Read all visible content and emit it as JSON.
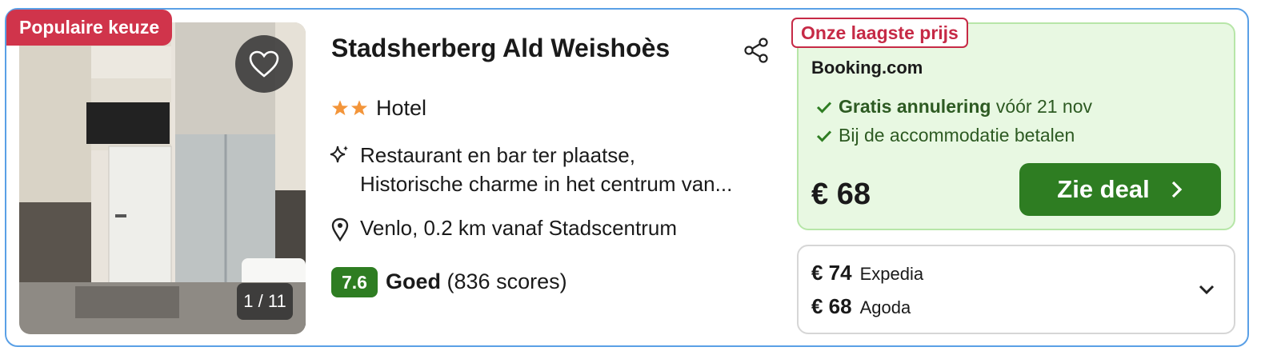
{
  "badge": {
    "popular": "Populaire keuze"
  },
  "image": {
    "counter": "1 / 11"
  },
  "hotel": {
    "name": "Stadsherberg Ald Weishoès",
    "stars": 2,
    "type": "Hotel",
    "amenities_line1": "Restaurant en bar ter plaatse,",
    "amenities_line2": "Historische charme in het centrum van...",
    "location": "Venlo, 0.2 km vanaf Stadscentrum",
    "rating_score": "7.6",
    "rating_label": "Goed",
    "rating_count": "(836 scores)"
  },
  "deal": {
    "tag": "Onze laagste prijs",
    "provider": "Booking.com",
    "perk1_bold": "Gratis annulering",
    "perk1_rest": "vóór 21 nov",
    "perk2": "Bij de accommodatie betalen",
    "price": "€ 68",
    "button": "Zie deal"
  },
  "other_offers": [
    {
      "price": "€ 74",
      "provider": "Expedia"
    },
    {
      "price": "€ 68",
      "provider": "Agoda"
    }
  ],
  "colors": {
    "accent_green": "#2e7d22",
    "badge_red": "#d0344b",
    "deal_bg": "#e8f8e2",
    "star": "#f3953a",
    "card_border": "#5aa0e6"
  },
  "icons": [
    "heart-icon",
    "share-icon",
    "star-icon",
    "sparkle-icon",
    "map-pin-icon",
    "check-icon",
    "chevron-right-icon",
    "chevron-down-icon"
  ]
}
